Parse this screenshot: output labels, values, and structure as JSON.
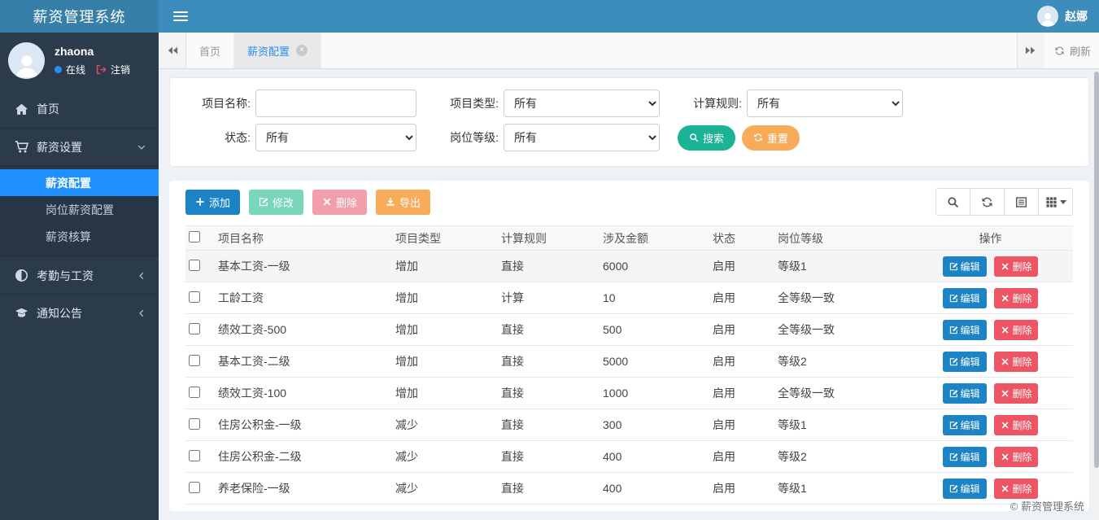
{
  "app": {
    "title": "薪资管理系统",
    "footer_copyright": "© 薪资管理系统"
  },
  "topbar": {
    "user_name": "赵娜"
  },
  "sidebar": {
    "user": {
      "name": "zhaona",
      "status_label": "在线",
      "logout_label": "注销"
    },
    "items": [
      {
        "label": "首页",
        "icon": "home-icon"
      },
      {
        "label": "薪资设置",
        "icon": "cart-icon",
        "expanded": true,
        "children": [
          {
            "label": "薪资配置",
            "active": true
          },
          {
            "label": "岗位薪资配置",
            "active": false
          },
          {
            "label": "薪资核算",
            "active": false
          }
        ]
      },
      {
        "label": "考勤与工资",
        "icon": "adjust-icon"
      },
      {
        "label": "通知公告",
        "icon": "graduation-cap-icon"
      }
    ]
  },
  "tabs": {
    "items": [
      {
        "label": "首页",
        "active": false
      },
      {
        "label": "薪资配置",
        "active": true,
        "closable": true
      }
    ],
    "refresh_label": "刷新"
  },
  "search": {
    "fields": [
      {
        "label": "项目名称:",
        "type": "input",
        "value": ""
      },
      {
        "label": "项目类型:",
        "type": "select",
        "value": "所有"
      },
      {
        "label": "计算规则:",
        "type": "select",
        "value": "所有"
      },
      {
        "label": "状态:",
        "type": "select",
        "value": "所有"
      },
      {
        "label": "岗位等级:",
        "type": "select",
        "value": "所有"
      }
    ],
    "search_label": "搜索",
    "reset_label": "重置"
  },
  "toolbar": {
    "add_label": "添加",
    "edit_label": "修改",
    "delete_label": "删除",
    "export_label": "导出"
  },
  "table": {
    "columns": [
      "项目名称",
      "项目类型",
      "计算规则",
      "涉及金额",
      "状态",
      "岗位等级",
      "操作"
    ],
    "edit_label": "编辑",
    "delete_label": "删除",
    "rows": [
      {
        "name": "基本工资-一级",
        "type": "增加",
        "rule": "直接",
        "amount": "6000",
        "status": "启用",
        "grade": "等级1"
      },
      {
        "name": "工龄工资",
        "type": "增加",
        "rule": "计算",
        "amount": "10",
        "status": "启用",
        "grade": "全等级一致"
      },
      {
        "name": "绩效工资-500",
        "type": "增加",
        "rule": "直接",
        "amount": "500",
        "status": "启用",
        "grade": "全等级一致"
      },
      {
        "name": "基本工资-二级",
        "type": "增加",
        "rule": "直接",
        "amount": "5000",
        "status": "启用",
        "grade": "等级2"
      },
      {
        "name": "绩效工资-100",
        "type": "增加",
        "rule": "直接",
        "amount": "1000",
        "status": "启用",
        "grade": "全等级一致"
      },
      {
        "name": "住房公积金-一级",
        "type": "减少",
        "rule": "直接",
        "amount": "300",
        "status": "启用",
        "grade": "等级1"
      },
      {
        "name": "住房公积金-二级",
        "type": "减少",
        "rule": "直接",
        "amount": "400",
        "status": "启用",
        "grade": "等级2"
      },
      {
        "name": "养老保险-一级",
        "type": "减少",
        "rule": "直接",
        "amount": "400",
        "status": "启用",
        "grade": "等级1"
      }
    ]
  },
  "colors": {
    "navbar": "#3c8dbc",
    "logo_bg": "#367fa9",
    "sidebar_bg": "#2c3b4b",
    "active_menu": "#1e90ff",
    "primary": "#1c84c6",
    "success": "#1ab394",
    "warning": "#f8ac59",
    "danger": "#ed5565",
    "tab_active_text": "#2d8cf0"
  }
}
